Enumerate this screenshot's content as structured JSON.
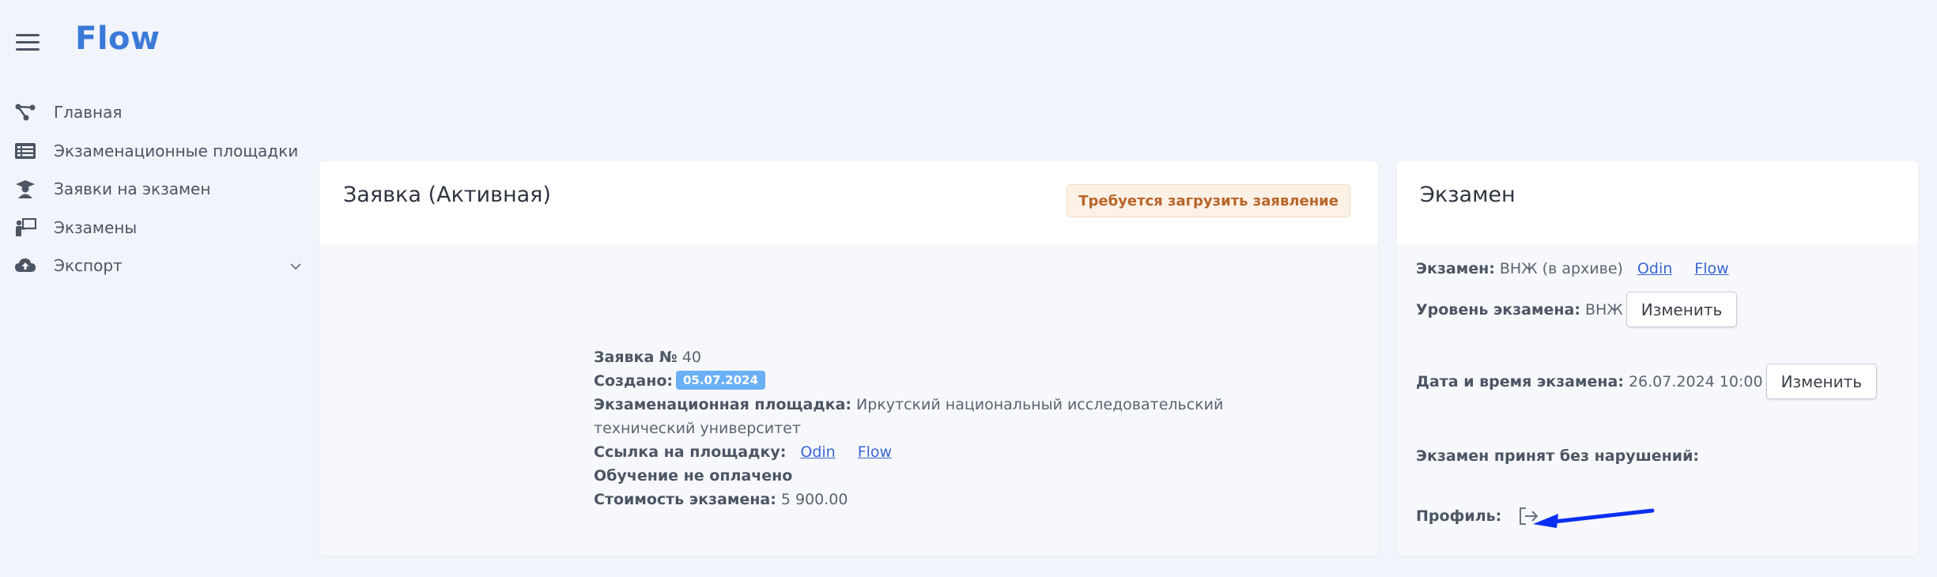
{
  "app": {
    "logo": "Flow"
  },
  "sidebar": {
    "items": [
      {
        "label": "Главная",
        "icon": "graph-nodes-icon"
      },
      {
        "label": "Экзаменационные площадки",
        "icon": "list-icon"
      },
      {
        "label": "Заявки на экзамен",
        "icon": "graduate-icon"
      },
      {
        "label": "Экзамены",
        "icon": "teacher-board-icon"
      },
      {
        "label": "Экспорт",
        "icon": "cloud-upload-icon"
      }
    ]
  },
  "application": {
    "title": "Заявка (Активная)",
    "warning": "Требуется загрузить заявление",
    "number_label": "Заявка №",
    "number_value": "40",
    "created_label": "Создано:",
    "created_value": "05.07.2024",
    "venue_label": "Экзаменационная площадка:",
    "venue_value": "Иркутский национальный исследовательский технический университет",
    "link_label": "Ссылка на площадку:",
    "link_1": "Odin",
    "link_2": "Flow",
    "payment_status": "Обучение не оплачено",
    "cost_label": "Стоимость экзамена:",
    "cost_value": "5 900.00"
  },
  "exam": {
    "title": "Экзамен",
    "exam_label": "Экзамен:",
    "exam_value": "ВНЖ (в архиве)",
    "link_1": "Odin",
    "link_2": "Flow",
    "level_label": "Уровень экзамена:",
    "level_value": "ВНЖ",
    "change_label": "Изменить",
    "datetime_label": "Дата и время экзамена:",
    "datetime_value": "26.07.2024 10:00",
    "accepted_label": "Экзамен принят без нарушений:",
    "profile_label": "Профиль:"
  },
  "colors": {
    "accent": "#3b7ad9",
    "link": "#3b66d1",
    "date_badge": "#6ab0f5",
    "warning_text": "#b8652a",
    "arrow": "#0b2ff0"
  }
}
